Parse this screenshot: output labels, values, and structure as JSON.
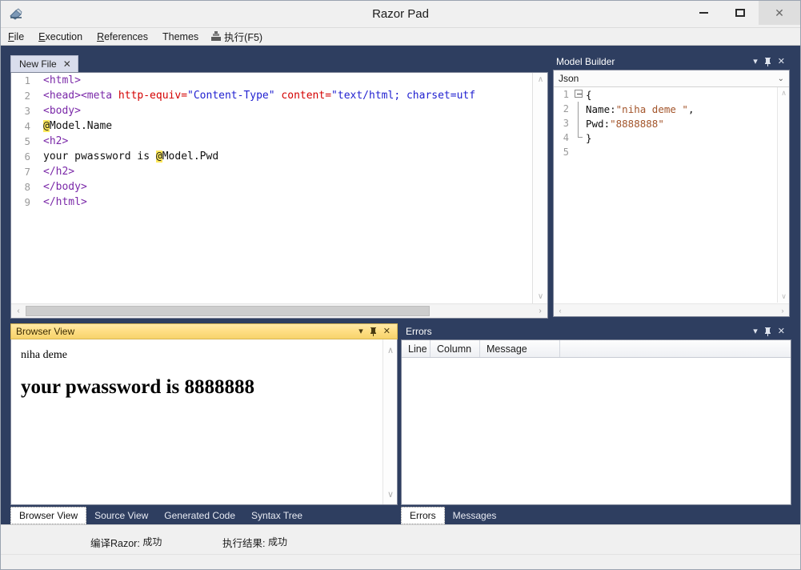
{
  "window": {
    "title": "Razor Pad",
    "app_icon": "razor-pad-icon",
    "minimize_label": "–",
    "maximize_label": "□",
    "close_label": "✕"
  },
  "menu": {
    "items": [
      {
        "label": "File",
        "mnemonic": "F"
      },
      {
        "label": "Execution",
        "mnemonic": "E"
      },
      {
        "label": "References",
        "mnemonic": "R"
      },
      {
        "label": "Themes",
        "mnemonic": ""
      }
    ],
    "run": {
      "label": "执行(F5)",
      "icon": "run-icon"
    }
  },
  "editor": {
    "tab": {
      "label": "New File",
      "close": "✕"
    },
    "lines": [
      {
        "n": "1",
        "segments": [
          {
            "t": "<html>",
            "c": "tok-tag"
          }
        ]
      },
      {
        "n": "2",
        "segments": [
          {
            "t": "<head><meta ",
            "c": "tok-tag"
          },
          {
            "t": "http-equiv=",
            "c": "tok-attr"
          },
          {
            "t": "\"Content-Type\"",
            "c": "tok-str"
          },
          {
            "t": " ",
            "c": "tok-plain"
          },
          {
            "t": "content=",
            "c": "tok-attr"
          },
          {
            "t": "\"text/html; charset=utf",
            "c": "tok-str"
          }
        ]
      },
      {
        "n": "3",
        "segments": [
          {
            "t": "<body>",
            "c": "tok-tag"
          }
        ]
      },
      {
        "n": "4",
        "segments": [
          {
            "t": "@",
            "c": "tok-at"
          },
          {
            "t": "Model.Name",
            "c": "tok-plain"
          }
        ]
      },
      {
        "n": "5",
        "segments": [
          {
            "t": "<h2>",
            "c": "tok-tag"
          }
        ]
      },
      {
        "n": "6",
        "segments": [
          {
            "t": "your pwassword is ",
            "c": "tok-plain"
          },
          {
            "t": "@",
            "c": "tok-at"
          },
          {
            "t": "Model.Pwd",
            "c": "tok-plain"
          }
        ]
      },
      {
        "n": "7",
        "segments": [
          {
            "t": "</h2>",
            "c": "tok-tag"
          }
        ]
      },
      {
        "n": "8",
        "segments": [
          {
            "t": "</body>",
            "c": "tok-tag"
          }
        ]
      },
      {
        "n": "9",
        "segments": [
          {
            "t": "</html>",
            "c": "tok-tag"
          }
        ]
      }
    ],
    "hscroll": {
      "left_arrow": "‹",
      "right_arrow": "›"
    },
    "vscroll": {
      "up_arrow": "∧",
      "down_arrow": "∨"
    }
  },
  "model_builder": {
    "title": "Model Builder",
    "collapse": "▾",
    "pin": "中",
    "close": "✕",
    "format": "Json",
    "format_caret": "⌄",
    "lines": [
      {
        "n": "1",
        "fold": "start",
        "segments": [
          {
            "t": "{",
            "c": ""
          }
        ]
      },
      {
        "n": "2",
        "fold": "mid",
        "segments": [
          {
            "t": "Name:",
            "c": ""
          },
          {
            "t": "\"niha deme \"",
            "c": "json-str"
          },
          {
            "t": ",",
            "c": ""
          }
        ]
      },
      {
        "n": "3",
        "fold": "mid",
        "segments": [
          {
            "t": "Pwd:",
            "c": ""
          },
          {
            "t": "\"8888888\"",
            "c": "json-str"
          }
        ]
      },
      {
        "n": "4",
        "fold": "end",
        "segments": [
          {
            "t": "}",
            "c": ""
          }
        ]
      },
      {
        "n": "5",
        "fold": "none",
        "segments": []
      }
    ]
  },
  "browser_view": {
    "title": "Browser View",
    "collapse": "▾",
    "pin": "中",
    "close": "✕",
    "content": {
      "name_text": "niha deme",
      "heading_text": "your pwassword is 8888888"
    },
    "tabs": [
      {
        "label": "Browser View",
        "active": true
      },
      {
        "label": "Source View",
        "active": false
      },
      {
        "label": "Generated Code",
        "active": false
      },
      {
        "label": "Syntax Tree",
        "active": false
      }
    ]
  },
  "errors": {
    "title": "Errors",
    "collapse": "▾",
    "pin": "中",
    "close": "✕",
    "columns": [
      "Line",
      "Column",
      "Message"
    ],
    "rows": [],
    "tabs": [
      {
        "label": "Errors",
        "active": true
      },
      {
        "label": "Messages",
        "active": false
      }
    ]
  },
  "status": {
    "compile_label": "编译Razor:",
    "compile_value": "成功",
    "run_label": "执行结果:",
    "run_value": "成功"
  },
  "colors": {
    "workspace": "#2e3e60",
    "browser_caption": "#ffdf86",
    "tab_active": "#d9ddec"
  }
}
